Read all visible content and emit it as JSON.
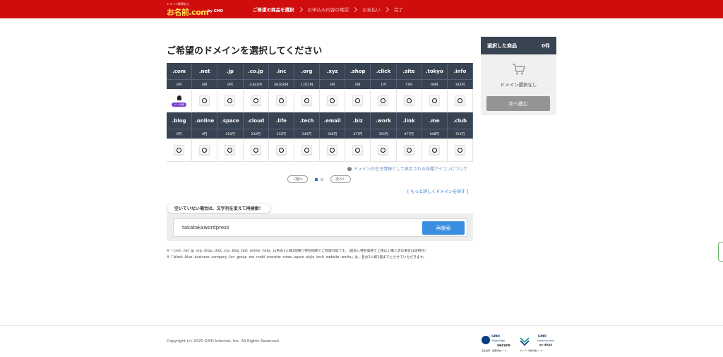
{
  "header": {
    "logo_small": "ドメイン取得なら",
    "logo_main": "お名前.com",
    "logo_gmo": "by GMO",
    "steps": [
      {
        "label": "ご希望の商品を選択",
        "active": true
      },
      {
        "label": "お申込み内容の確認",
        "active": false
      },
      {
        "label": "お支払い",
        "active": false
      },
      {
        "label": "完了",
        "active": false
      }
    ]
  },
  "main": {
    "title": "ご希望のドメインを選択してください",
    "rows": [
      {
        "tlds": [
          ".com",
          ".net",
          ".jp",
          ".co.jp",
          ".inc",
          ".org",
          ".xyz",
          ".shop",
          ".click",
          ".site",
          ".tokyo",
          ".info"
        ],
        "prices": [
          "0円",
          "0円",
          "0円",
          "4,841円",
          "48,656円",
          "1,051円",
          "0円",
          "0円",
          "1円",
          "73円",
          "98円",
          "342円"
        ]
      },
      {
        "tlds": [
          ".blog",
          ".online",
          ".space",
          ".cloud",
          ".life",
          ".tech",
          ".email",
          ".biz",
          ".work",
          ".link",
          ".me",
          ".club"
        ],
        "prices": [
          "0円",
          "0円",
          "110円",
          "232円",
          "232円",
          "245円",
          "306円",
          "477円",
          "355円",
          "477円",
          "648円",
          "721円"
        ]
      }
    ],
    "first_cell_badge": "メール通知",
    "icon_note": "ドメインの空き情報として表示される各種アイコンについて",
    "pager": {
      "prev": "前へ",
      "next": "次へ",
      "current_page": 1,
      "total_pages": 2
    },
    "more_link": "[ もっと詳しくドメインを探す ]",
    "research_bubble": "空いていない場合は、文字列を変えて再検索！",
    "search": {
      "value": "takatakawordpress",
      "button": "再検索"
    },
    "notes": [
      "※「.com .net .jp .org .shop .click .xyz .blog .fast .online .help」は各お1人様1個限り特別価格でご登録可能です。（過去に特別価格で上限以上購入済の場合は適用外）",
      "※「.black .blue .business .company .fun .group .me .mobi .monster .news .space .style .tech .website .works」は、各お1人様1個までとさせていただきます。"
    ]
  },
  "side": {
    "heading": "選択した商品",
    "count": "0件",
    "empty": "ドメイン選択なし",
    "next_button": "次へ進む"
  },
  "footer": {
    "copyright": "Copyright (c) 2025 GMO Internet, Inc. All Rights Reserved.",
    "seal1": {
      "t1": "GMO",
      "t2": "GlobalSign",
      "t3": "secure",
      "t4": "実在証明・盗聴対策シール"
    },
    "seal2": {
      "t1": "GMO",
      "t2": "CYBER SECURITY",
      "t3": "by IERAE",
      "t4": "サイバー攻撃対策シール"
    }
  },
  "colors": {
    "header_red": "#d00d0d",
    "table_head": "#394453",
    "accent_blue": "#3a8ee0"
  }
}
